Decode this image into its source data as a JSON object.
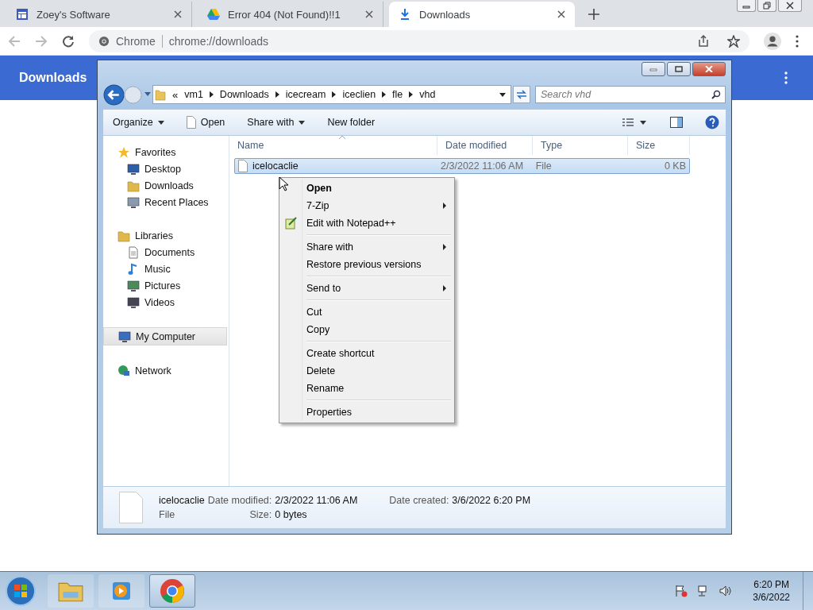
{
  "browser": {
    "tabs": [
      {
        "title": "Zoey's Software",
        "selected": false
      },
      {
        "title": "Error 404 (Not Found)!!1",
        "selected": false
      },
      {
        "title": "Downloads",
        "selected": true
      }
    ],
    "omnibox": {
      "site": "Chrome",
      "url": "chrome://downloads"
    },
    "page_title": "Downloads"
  },
  "explorer": {
    "overflow": "«",
    "breadcrumb": [
      "vm1",
      "Downloads",
      "icecream",
      "iceclien",
      "fle",
      "vhd"
    ],
    "search": {
      "placeholder": "Search vhd"
    },
    "commands": [
      {
        "label": "Organize",
        "kind": "menu"
      },
      {
        "label": "Open",
        "kind": "file"
      },
      {
        "label": "Share with",
        "kind": "menu"
      },
      {
        "label": "New folder",
        "kind": "plain"
      }
    ],
    "nav": [
      {
        "label": "Favorites",
        "selected": false,
        "children": [
          {
            "label": "Desktop",
            "selected": false
          },
          {
            "label": "Downloads",
            "selected": false
          },
          {
            "label": "Recent Places",
            "selected": false
          }
        ]
      },
      {
        "label": "Libraries",
        "selected": false,
        "children": [
          {
            "label": "Documents",
            "selected": false
          },
          {
            "label": "Music",
            "selected": false
          },
          {
            "label": "Pictures",
            "selected": false
          },
          {
            "label": "Videos",
            "selected": false
          }
        ]
      },
      {
        "label": "My Computer",
        "selected": true
      },
      {
        "label": "Network",
        "selected": false
      }
    ],
    "columns": [
      "Name",
      "Date modified",
      "Type",
      "Size"
    ],
    "rows": [
      {
        "name": "icelocaclie",
        "date": "2/3/2022 11:06 AM",
        "type": "File",
        "size": "0 KB",
        "selected": true
      }
    ],
    "details": {
      "name": "icelocaclie",
      "type": "File",
      "fields": [
        {
          "label": "Date modified:",
          "value": "2/3/2022 11:06 AM"
        },
        {
          "label": "Date created:",
          "value": "3/6/2022 6:20 PM"
        },
        {
          "label": "Size:",
          "value": "0 bytes"
        }
      ]
    }
  },
  "context_menu": [
    [
      {
        "label": "Open",
        "default": true,
        "submenu": false
      },
      {
        "label": "7-Zip",
        "default": false,
        "submenu": true
      },
      {
        "label": "Edit with Notepad++",
        "default": false,
        "submenu": false
      }
    ],
    [
      {
        "label": "Share with",
        "default": false,
        "submenu": true
      },
      {
        "label": "Restore previous versions",
        "default": false,
        "submenu": false
      }
    ],
    [
      {
        "label": "Send to",
        "default": false,
        "submenu": true
      }
    ],
    [
      {
        "label": "Cut",
        "default": false,
        "submenu": false
      },
      {
        "label": "Copy",
        "default": false,
        "submenu": false
      }
    ],
    [
      {
        "label": "Create shortcut",
        "default": false,
        "submenu": false
      },
      {
        "label": "Delete",
        "default": false,
        "submenu": false
      },
      {
        "label": "Rename",
        "default": false,
        "submenu": false
      }
    ],
    [
      {
        "label": "Properties",
        "default": false,
        "submenu": false
      }
    ]
  ],
  "taskbar": {
    "apps": [
      {
        "selected": false
      },
      {
        "selected": false
      },
      {
        "selected": true
      }
    ],
    "time": "6:20 PM",
    "date": "3/6/2022"
  }
}
